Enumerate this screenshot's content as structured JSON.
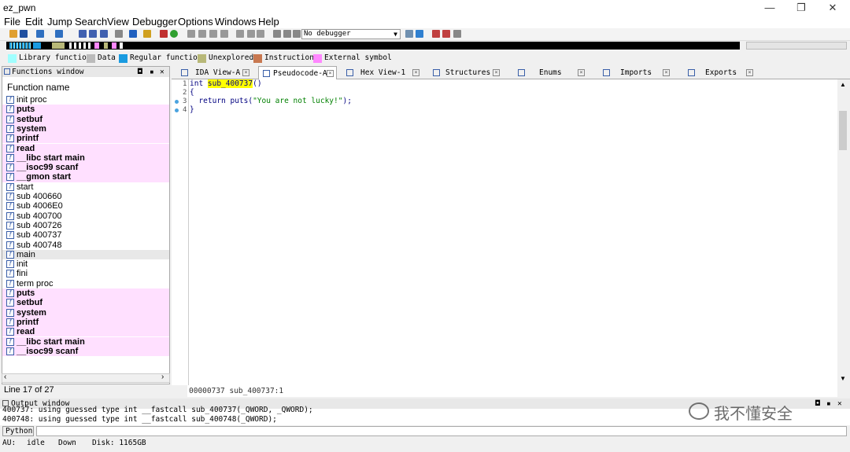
{
  "window": {
    "title": "ez_pwn",
    "minimize_label": "—",
    "maximize_label": "❐",
    "close_label": "✕"
  },
  "menu": [
    "File",
    "Edit",
    "Jump",
    "Search",
    "View",
    "Debugger",
    "Options",
    "Windows",
    "Help"
  ],
  "toolbar": {
    "debugger_select": "No debugger"
  },
  "legend": [
    {
      "label": "Library function",
      "color": "#a0ffff"
    },
    {
      "label": "Data",
      "color": "#bbbbbb"
    },
    {
      "label": "Regular function",
      "color": "#1a9be0"
    },
    {
      "label": "Unexplored",
      "color": "#b8b878"
    },
    {
      "label": "Instruction",
      "color": "#c87850"
    },
    {
      "label": "External symbol",
      "color": "#ff88ff"
    }
  ],
  "functions_window": {
    "title": "Functions window",
    "column_header": "Function name",
    "line_status": "Line 17 of 27",
    "items": [
      {
        "name": "init proc",
        "lib": false
      },
      {
        "name": "puts",
        "lib": true
      },
      {
        "name": "setbuf",
        "lib": true
      },
      {
        "name": "system",
        "lib": true
      },
      {
        "name": "printf",
        "lib": true
      },
      {
        "name": "read",
        "lib": true
      },
      {
        "name": "__libc start main",
        "lib": true
      },
      {
        "name": "__isoc99 scanf",
        "lib": true
      },
      {
        "name": "__gmon start",
        "lib": true
      },
      {
        "name": "start",
        "lib": false
      },
      {
        "name": "sub 400660",
        "lib": false
      },
      {
        "name": "sub 4006E0",
        "lib": false
      },
      {
        "name": "sub 400700",
        "lib": false
      },
      {
        "name": "sub 400726",
        "lib": false
      },
      {
        "name": "sub 400737",
        "lib": false
      },
      {
        "name": "sub 400748",
        "lib": false
      },
      {
        "name": "main",
        "lib": false,
        "selected": true
      },
      {
        "name": "init",
        "lib": false
      },
      {
        "name": "fini",
        "lib": false
      },
      {
        "name": "term proc",
        "lib": false
      },
      {
        "name": "puts",
        "lib": true
      },
      {
        "name": "setbuf",
        "lib": true
      },
      {
        "name": "system",
        "lib": true
      },
      {
        "name": "printf",
        "lib": true
      },
      {
        "name": "read",
        "lib": true
      },
      {
        "name": "__libc start main",
        "lib": true
      },
      {
        "name": "__isoc99 scanf",
        "lib": true
      }
    ]
  },
  "tabs": [
    {
      "label": "IDA View-A",
      "active": false
    },
    {
      "label": "Pseudocode-A",
      "active": true
    },
    {
      "label": "Hex View-1",
      "active": false
    },
    {
      "label": "Structures",
      "active": false
    },
    {
      "label": "Enums",
      "active": false
    },
    {
      "label": "Imports",
      "active": false
    },
    {
      "label": "Exports",
      "active": false
    }
  ],
  "pseudocode": {
    "line_numbers": [
      "1",
      "2",
      "3",
      "4"
    ],
    "line1_type": "int ",
    "line1_func": "sub_400737",
    "line1_rest": "()",
    "line2": "{",
    "line3_pre": "  return puts(",
    "line3_str": "\"You are not lucky!\"",
    "line3_post": ");",
    "line4": "}",
    "status": "00000737 sub_400737:1"
  },
  "output_window": {
    "title": "Output window",
    "lines": [
      "400737: using guessed type int __fastcall sub_400737(_QWORD, _QWORD);",
      "400748: using guessed type int __fastcall sub_400748(_QWORD);"
    ],
    "python_button": "Python"
  },
  "statusbar": {
    "au": "AU:",
    "state": "idle",
    "direction": "Down",
    "disk": "Disk: 1165GB"
  },
  "watermark": "我不懂安全"
}
